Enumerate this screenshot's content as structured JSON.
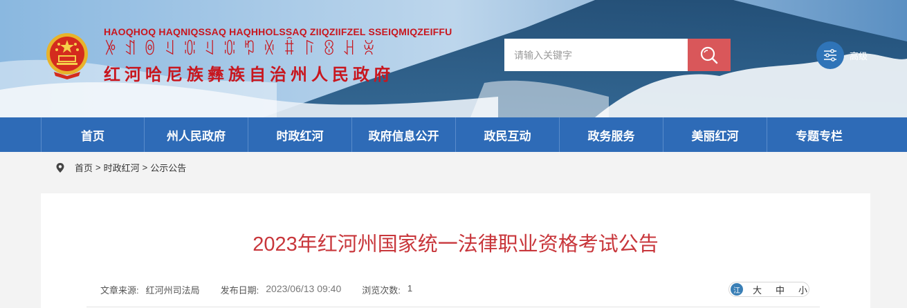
{
  "header": {
    "title_en": "HAOQHOQ HAQNIQSSAQ HAQHHOLSSAQ ZIIQZIIFZEL SSEIQMIQZEIFFU",
    "title_yi": "ꉼꀊꉻꆹꁤꆹꁤꑳꏾꐙꑍꐪꃅꌞ",
    "title_cn": "红河哈尼族彝族自治州人民政府",
    "emblem_icon": "national-emblem-icon"
  },
  "search": {
    "placeholder": "请输入关键字",
    "button_icon": "search-icon",
    "advanced_label": "高级",
    "advanced_icon": "sliders-icon"
  },
  "nav": {
    "items": [
      {
        "label": "首页"
      },
      {
        "label": "州人民政府"
      },
      {
        "label": "时政红河"
      },
      {
        "label": "政府信息公开"
      },
      {
        "label": "政民互动"
      },
      {
        "label": "政务服务"
      },
      {
        "label": "美丽红河"
      },
      {
        "label": "专题专栏"
      }
    ]
  },
  "breadcrumb": {
    "icon": "location-pin-icon",
    "items": [
      "首页",
      "时政红河",
      "公示公告"
    ],
    "separator": ">"
  },
  "article": {
    "title": "2023年红河州国家统一法律职业资格考试公告",
    "source_label": "文章来源:",
    "source_value": "红河州司法局",
    "date_label": "发布日期:",
    "date_value": "2023/06/13 09:40",
    "views_label": "浏览次数:",
    "views_value": "1",
    "font_icon_text": "江",
    "font_sizes": [
      "大",
      "中",
      "小"
    ]
  },
  "colors": {
    "nav_bg": "#2e6bb7",
    "title_red": "#c8161e",
    "search_btn": "#d9575a",
    "article_title": "#c8363b"
  }
}
